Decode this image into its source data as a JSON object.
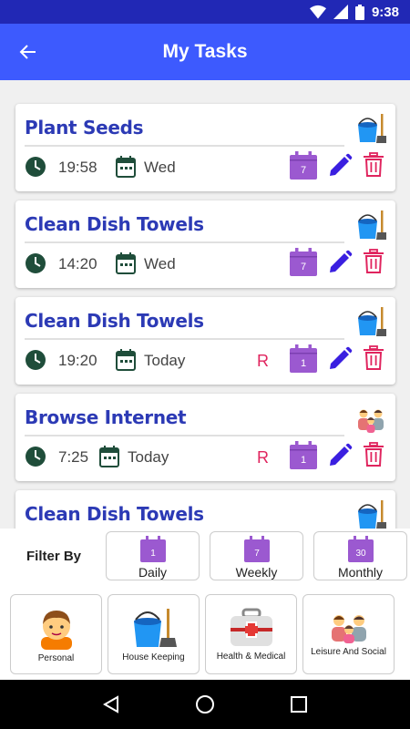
{
  "status_bar": {
    "time": "9:38"
  },
  "app_bar": {
    "title": "My Tasks"
  },
  "tasks": [
    {
      "title": "Plant Seeds",
      "time": "19:58",
      "day": "Wed",
      "repeat": "",
      "calendar_num": "7",
      "category_icon": "bucket-mop-icon"
    },
    {
      "title": "Clean Dish Towels",
      "time": "14:20",
      "day": "Wed",
      "repeat": "",
      "calendar_num": "7",
      "category_icon": "bucket-mop-icon"
    },
    {
      "title": "Clean Dish Towels",
      "time": "19:20",
      "day": "Today",
      "repeat": "R",
      "calendar_num": "1",
      "category_icon": "bucket-mop-icon"
    },
    {
      "title": "Browse Internet",
      "time": "7:25",
      "day": "Today",
      "repeat": "R",
      "calendar_num": "1",
      "category_icon": "family-icon"
    },
    {
      "title": "Clean Dish Towels",
      "time": "",
      "day": "",
      "repeat": "",
      "calendar_num": "",
      "category_icon": "bucket-mop-icon"
    }
  ],
  "filter": {
    "label": "Filter By",
    "options": [
      {
        "label": "Daily",
        "num": "1"
      },
      {
        "label": "Weekly",
        "num": "7"
      },
      {
        "label": "Monthly",
        "num": "30"
      }
    ],
    "categories": [
      {
        "label": "Personal",
        "icon": "boy-face-icon"
      },
      {
        "label": "House Keeping",
        "icon": "bucket-mop-icon"
      },
      {
        "label": "Health & Medical",
        "icon": "first-aid-kit-icon"
      },
      {
        "label": "Leisure And Social",
        "icon": "family-icon"
      }
    ]
  },
  "colors": {
    "status_bar": "#2128b5",
    "app_bar": "#3d5afe",
    "title_blue": "#2c3ab5",
    "calendar_purple": "#9b59d0",
    "edit_blue": "#3a1fe0",
    "delete_pink": "#e0245e",
    "icon_green": "#1f4d3a"
  }
}
